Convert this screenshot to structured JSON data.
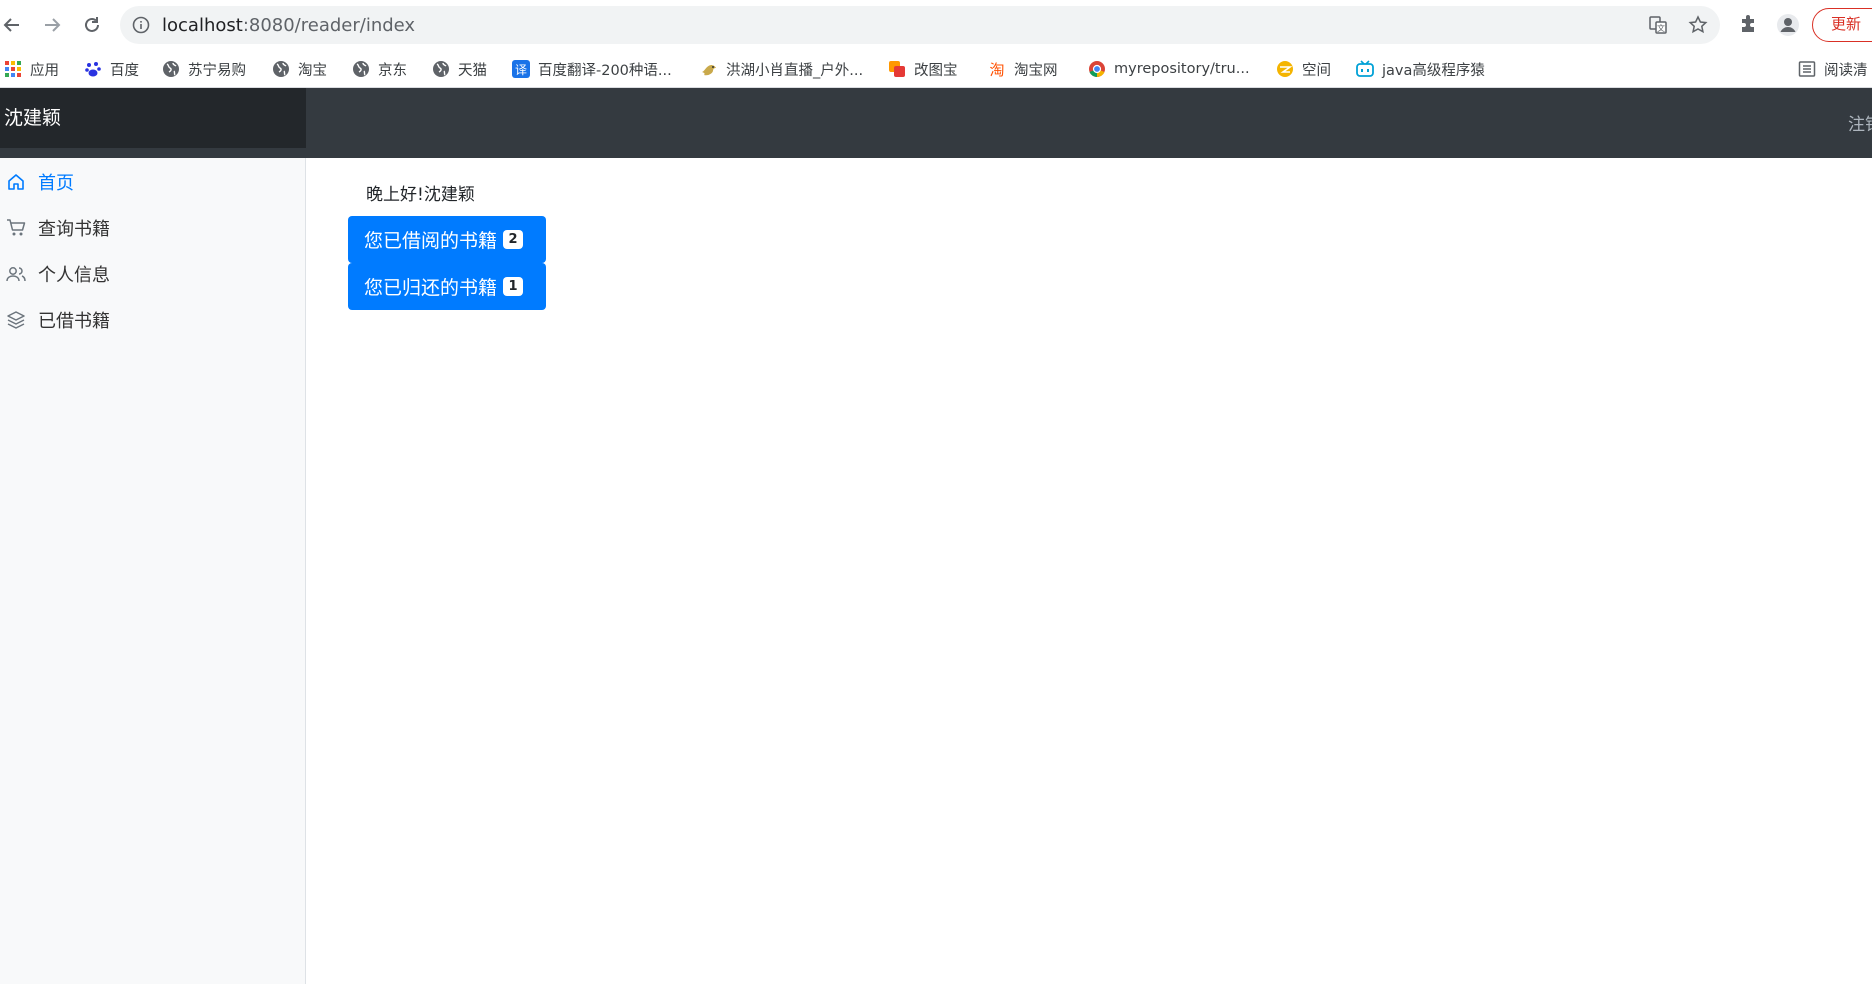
{
  "browser": {
    "url_host": "localhost",
    "url_path": ":8080/reader/index",
    "update_label": "更新",
    "bookmarks": [
      {
        "label": "应用",
        "icon": "apps-grid-icon",
        "color": "#ea4335"
      },
      {
        "label": "百度",
        "icon": "baidu-paw-icon",
        "color": "#2932e1"
      },
      {
        "label": "苏宁易购",
        "icon": "globe-icon",
        "color": "#5f6368"
      },
      {
        "label": "淘宝",
        "icon": "globe-icon",
        "color": "#5f6368"
      },
      {
        "label": "京东",
        "icon": "globe-icon",
        "color": "#5f6368"
      },
      {
        "label": "天猫",
        "icon": "globe-icon",
        "color": "#5f6368"
      },
      {
        "label": "百度翻译-200种语...",
        "icon": "translate-icon",
        "color": "#1a73e8"
      },
      {
        "label": "洪湖小肖直播_户外...",
        "icon": "bird-icon",
        "color": "#8a6d3b"
      },
      {
        "label": "改图宝",
        "icon": "image-editor-icon",
        "color": "#f57c00"
      },
      {
        "label": "淘宝网",
        "icon": "taobao-icon",
        "color": "#ff5000"
      },
      {
        "label": "myrepository/tru...",
        "icon": "chrome-icon",
        "color": "#db4437"
      },
      {
        "label": "空间",
        "icon": "qzone-icon",
        "color": "#f4b400"
      },
      {
        "label": "java高级程序猿",
        "icon": "bilibili-icon",
        "color": "#00a1d6"
      }
    ],
    "reading_list_label": "阅读清"
  },
  "app": {
    "brand": "沈建颖",
    "header_right": "注销",
    "sidebar": [
      {
        "label": "首页",
        "icon": "home-icon",
        "active": true
      },
      {
        "label": "查询书籍",
        "icon": "cart-icon",
        "active": false
      },
      {
        "label": "个人信息",
        "icon": "users-icon",
        "active": false
      },
      {
        "label": "已借书籍",
        "icon": "layers-icon",
        "active": false
      }
    ],
    "greeting": "晚上好!沈建颖",
    "borrowed_label": "您已借阅的书籍",
    "borrowed_count": "2",
    "returned_label": "您已归还的书籍",
    "returned_count": "1"
  },
  "colors": {
    "primary": "#007bff",
    "header_bg": "#343a40",
    "brand_bg": "#23272b",
    "sidebar_bg": "#f8f9fa"
  }
}
